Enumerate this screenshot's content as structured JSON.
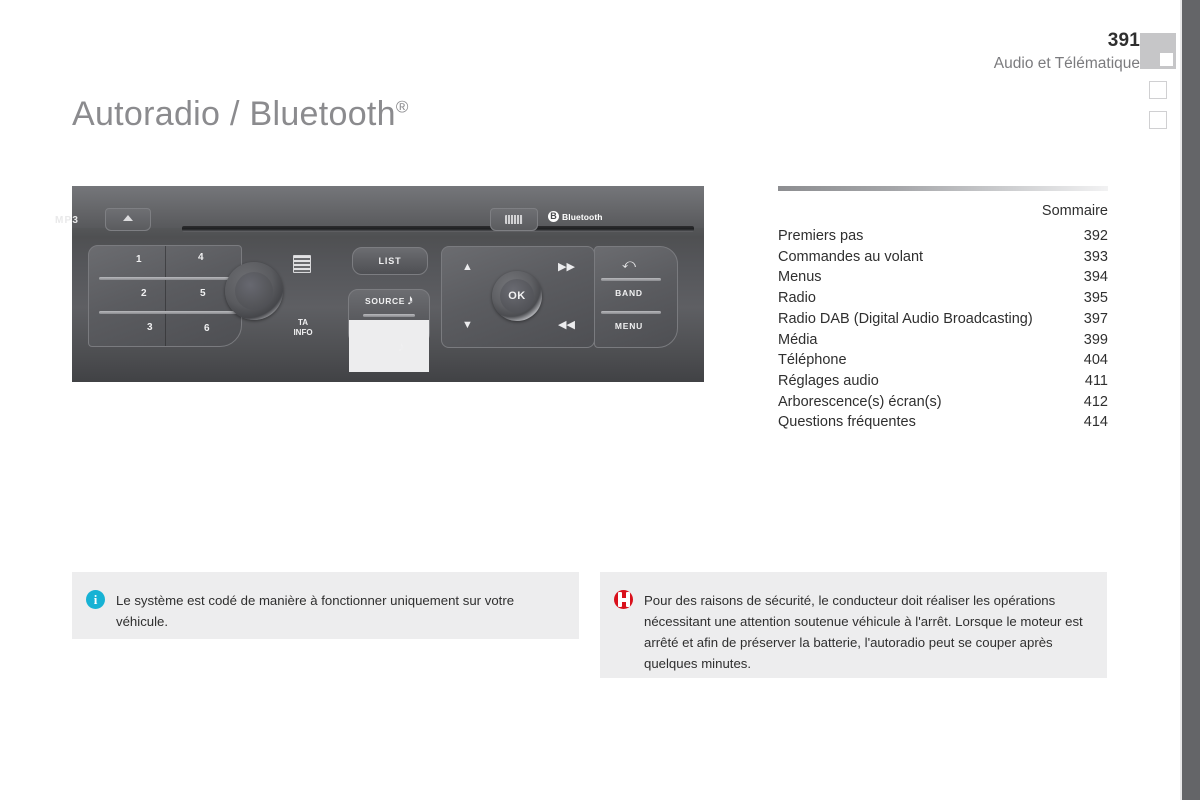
{
  "header": {
    "page_number": "391",
    "section_title": "Audio et Télématique"
  },
  "page_title": {
    "text": "Autoradio / Bluetooth",
    "registered_mark": "®"
  },
  "radio_unit": {
    "media_label": "MP3",
    "eject_icon": "eject-icon",
    "cd_icon": "cd-slot-icon",
    "bluetooth_mark": "B",
    "bluetooth_label": "Bluetooth",
    "presets": [
      "1",
      "2",
      "3",
      "4",
      "5",
      "6"
    ],
    "list_glyph_icon": "list-lines-icon",
    "ta_info_label_line1": "TA",
    "ta_info_label_line2": "INFO",
    "list_button": "LIST",
    "source_button": "SOURCE",
    "source_pen_icon": "pen-icon",
    "source_note_icon": "♪",
    "ok_button": "OK",
    "nav_up": "▲",
    "nav_down": "▼",
    "nav_forward": "▶▶",
    "nav_back": "◀◀",
    "back_button": "⤺",
    "band_button": "BAND",
    "menu_button": "MENU"
  },
  "toc": {
    "heading": "Sommaire",
    "entries": [
      {
        "title": "Premiers pas",
        "page": "392"
      },
      {
        "title": "Commandes au volant",
        "page": "393"
      },
      {
        "title": "Menus",
        "page": "394"
      },
      {
        "title": "Radio",
        "page": "395"
      },
      {
        "title": "Radio DAB (Digital Audio Broadcasting)",
        "page": "397"
      },
      {
        "title": "Média",
        "page": "399"
      },
      {
        "title": "Téléphone",
        "page": "404"
      },
      {
        "title": "Réglages audio",
        "page": "411"
      },
      {
        "title": "Arborescence(s) écran(s)",
        "page": "412"
      },
      {
        "title": "Questions fréquentes",
        "page": "414"
      }
    ]
  },
  "notes": {
    "info": {
      "icon": "info-icon",
      "icon_glyph": "i",
      "color": "#17b2d4",
      "text": "Le système est codé de manière à fonctionner uniquement sur votre véhicule."
    },
    "warning": {
      "icon": "warning-icon",
      "color": "#d9111c",
      "text": "Pour des raisons de sécurité, le conducteur doit réaliser les opérations nécessitant une attention soutenue véhicule à l'arrêt. Lorsque le moteur est arrêté et afin de préserver la batterie, l'autoradio peut se couper après quelques minutes."
    }
  },
  "tab_markers": {
    "active_index": 0,
    "count": 3
  }
}
